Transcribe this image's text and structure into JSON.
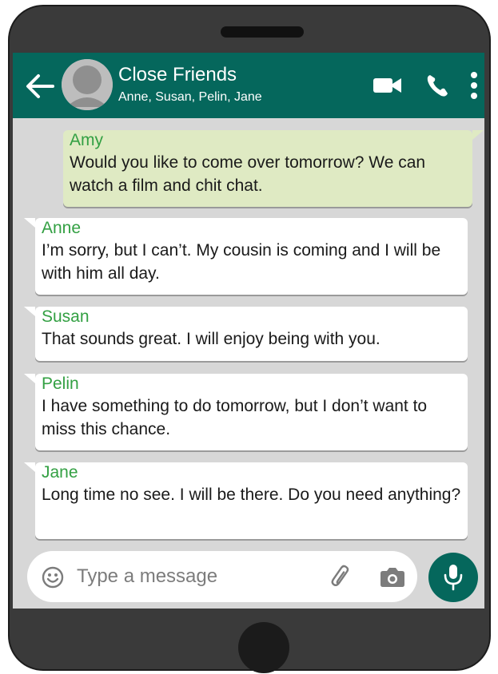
{
  "header": {
    "title": "Close Friends",
    "subtitle": "Anne, Susan, Pelin, Jane",
    "colors": {
      "bar": "#05675c",
      "text": "#ffffff"
    },
    "icons": [
      "back-arrow-icon",
      "avatar",
      "video-call-icon",
      "phone-call-icon",
      "more-vertical-icon"
    ]
  },
  "messages": [
    {
      "sender": "Amy",
      "text": "Would you like to come over tomorrow? We can watch a film and chit chat.",
      "direction": "outgoing"
    },
    {
      "sender": "Anne",
      "text": "I’m sorry, but I can’t. My cousin is coming and I will be with him all day.",
      "direction": "incoming"
    },
    {
      "sender": "Susan",
      "text": "That sounds great. I will enjoy being with you.",
      "direction": "incoming"
    },
    {
      "sender": "Pelin",
      "text": "I have something to do tomorrow, but I don’t want to miss this chance.",
      "direction": "incoming"
    },
    {
      "sender": "Jane",
      "text": "Long time no see. I will be there. Do you need anything?",
      "direction": "incoming"
    }
  ],
  "composer": {
    "placeholder": "Type a message",
    "icons": [
      "emoji-icon",
      "paperclip-icon",
      "camera-icon",
      "microphone-icon"
    ]
  },
  "colors": {
    "sender_name": "#33a043",
    "outgoing_bubble": "#dfeac3",
    "incoming_bubble": "#ffffff",
    "chat_background": "#d7d7d7"
  }
}
